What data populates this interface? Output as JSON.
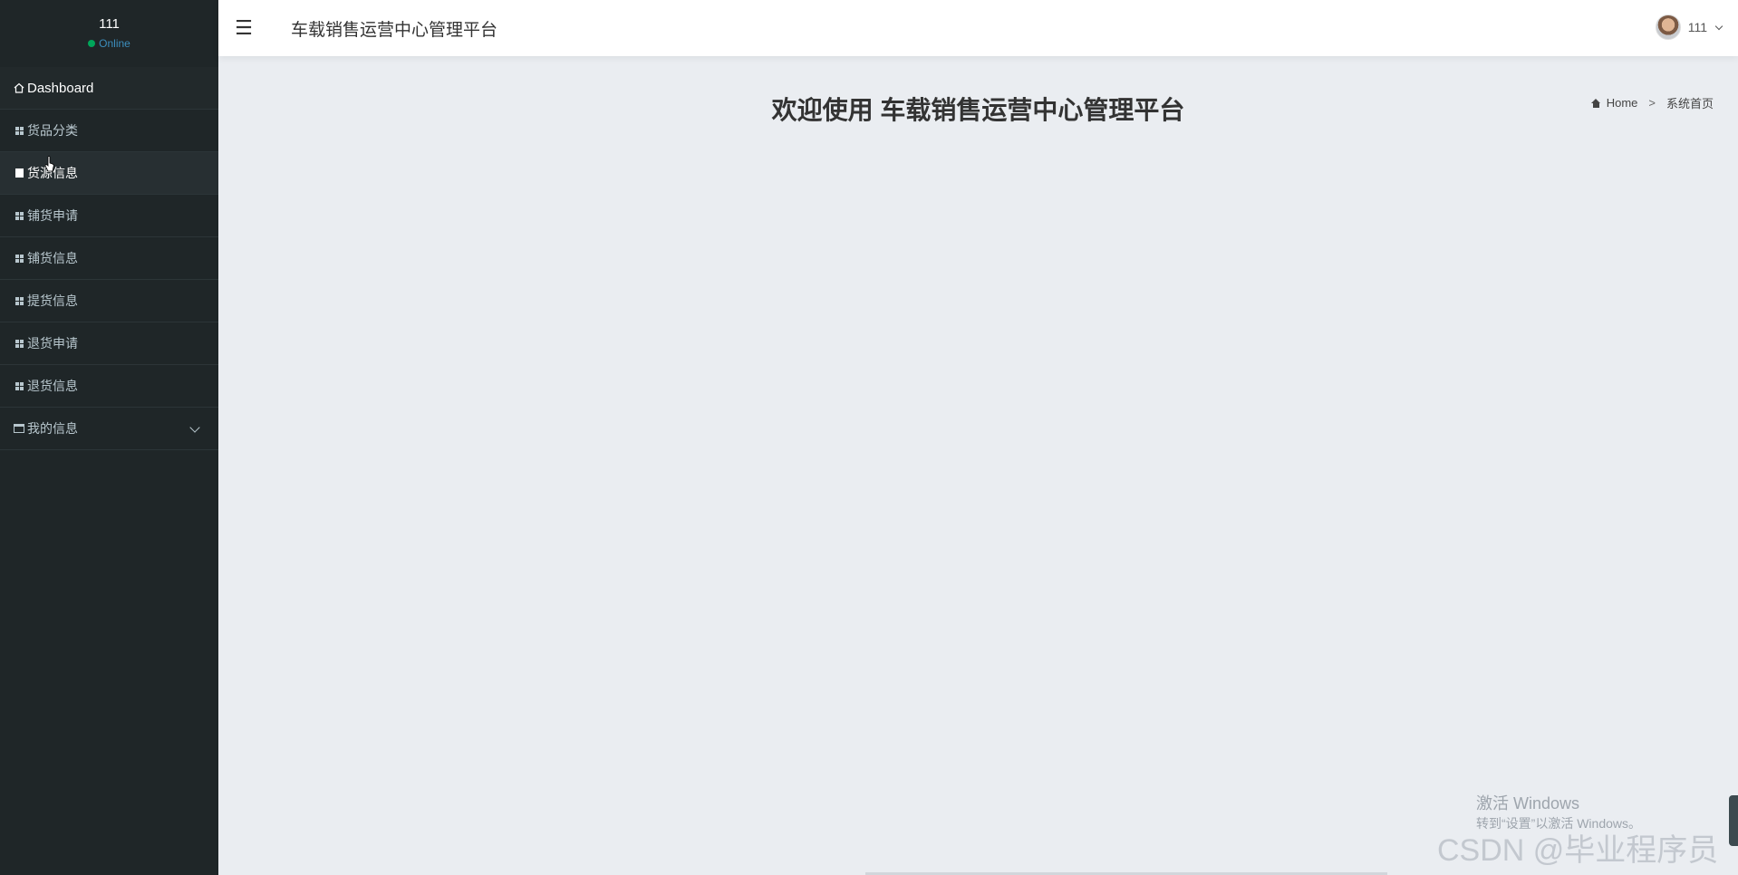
{
  "sidebar": {
    "user_name": "111",
    "user_status": "Online",
    "items": [
      {
        "label": "Dashboard",
        "icon": "home-icon"
      },
      {
        "label": "货品分类",
        "icon": "grid-icon"
      },
      {
        "label": "货源信息",
        "icon": "file-icon"
      },
      {
        "label": "铺货申请",
        "icon": "grid-icon"
      },
      {
        "label": "铺货信息",
        "icon": "grid-icon"
      },
      {
        "label": "提货信息",
        "icon": "grid-icon"
      },
      {
        "label": "退货申请",
        "icon": "grid-icon"
      },
      {
        "label": "退货信息",
        "icon": "grid-icon"
      },
      {
        "label": "我的信息",
        "icon": "card-icon"
      }
    ]
  },
  "header": {
    "toggle_glyph": "☰",
    "title": "车载销售运营中心管理平台",
    "user_name": "111"
  },
  "main": {
    "welcome": "欢迎使用 车载销售运营中心管理平台",
    "breadcrumb": {
      "home": "Home",
      "separator": ">",
      "current": "系统首页"
    }
  },
  "overlay": {
    "activate_title": "激活 Windows",
    "activate_hint": "转到“设置”以激活 Windows。",
    "csdn": "CSDN @毕业程序员"
  },
  "colors": {
    "sidebar_bg": "#1f2628",
    "status_online": "#00a65a",
    "content_bg": "#eaedf1"
  }
}
